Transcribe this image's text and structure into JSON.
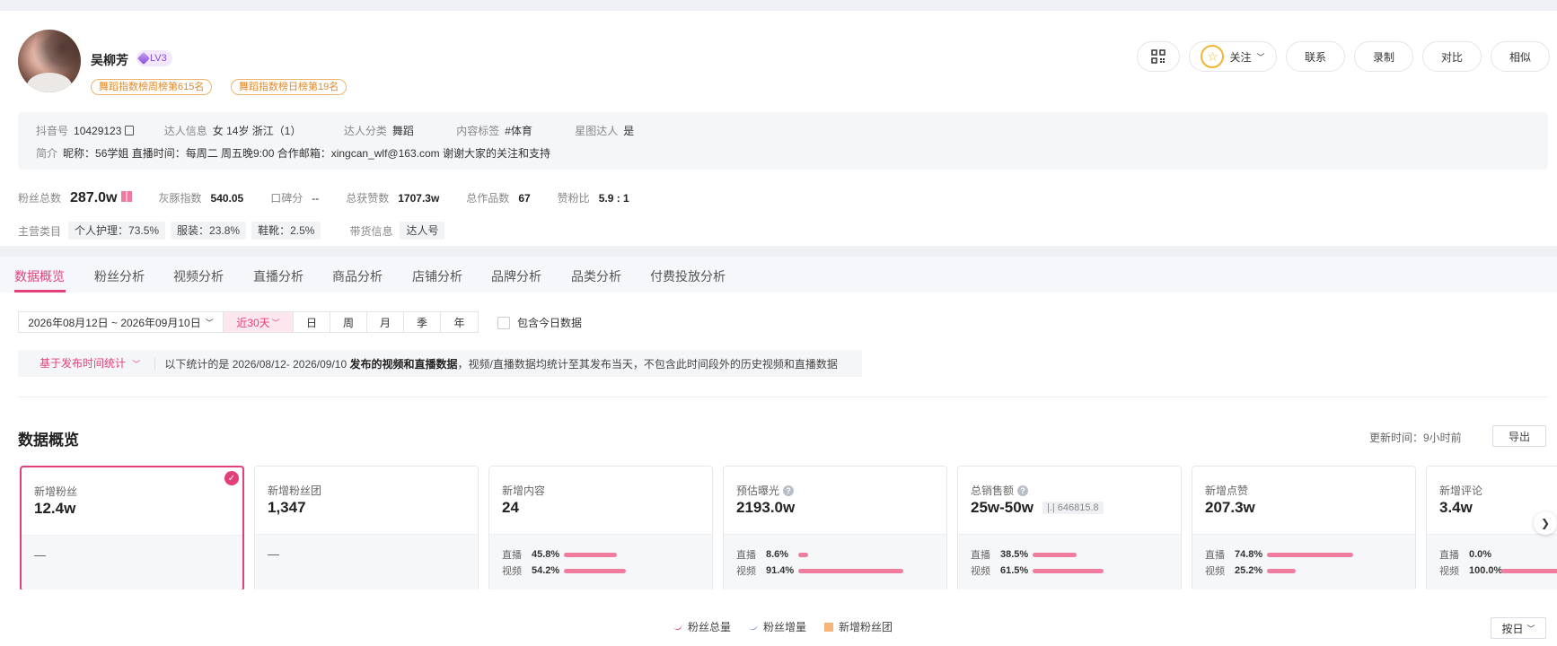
{
  "profile": {
    "name": "吴柳芳",
    "level": "LV3",
    "ranks": [
      "舞蹈指数榜周榜第615名",
      "舞蹈指数榜日榜第19名"
    ],
    "buttons": {
      "follow": "关注",
      "contact": "联系",
      "record": "录制",
      "compare": "对比",
      "similar": "相似"
    },
    "info": {
      "douyin_label": "抖音号",
      "douyin_value": "10429123",
      "talent_label": "达人信息",
      "talent_value": "女 14岁 浙江（1）",
      "category_label": "达人分类",
      "category_value": "舞蹈",
      "tag_label": "内容标签",
      "tag_value": "#体育",
      "star_label": "星图达人",
      "star_value": "是",
      "bio_label": "简介",
      "bio_value": "昵称：56学姐 直播时间：每周二 周五晚9:00 合作邮箱：xingcan_wlf@163.com 谢谢大家的关注和支持"
    },
    "stats": {
      "fans_label": "粉丝总数",
      "fans_value": "287.0w",
      "index_label": "灰豚指数",
      "index_value": "540.05",
      "rep_label": "口碑分",
      "rep_value": "--",
      "likes_label": "总获赞数",
      "likes_value": "1707.3w",
      "works_label": "总作品数",
      "works_value": "67",
      "ratio_label": "赞粉比",
      "ratio_value": "5.9 : 1"
    },
    "cats": {
      "main_label": "主营类目",
      "items": [
        "个人护理：73.5%",
        "服装：23.8%",
        "鞋靴：2.5%"
      ],
      "goods_label": "带货信息",
      "goods_value": "达人号"
    }
  },
  "tabs": [
    "数据概览",
    "粉丝分析",
    "视频分析",
    "直播分析",
    "商品分析",
    "店铺分析",
    "品牌分析",
    "品类分析",
    "付费投放分析"
  ],
  "filters": {
    "date_range": "2026年08月12日 ~ 2026年09月10日",
    "recent": "近30天",
    "periods": [
      "日",
      "周",
      "月",
      "季",
      "年"
    ],
    "include_today": "包含今日数据"
  },
  "notice": {
    "basis": "基于发布时间统计",
    "prefix": "以下统计的是 2026/08/12- 2026/09/10 ",
    "bold": "发布的视频和直播数据",
    "suffix": "，视频/直播数据均统计至其发布当天，不包含此时间段外的历史视频和直播数据"
  },
  "overview": {
    "title": "数据概览",
    "update_time": "更新时间：9小时前",
    "export": "导出",
    "cards": [
      {
        "title": "新增粉丝",
        "value": "12.4w",
        "dash": "—"
      },
      {
        "title": "新增粉丝团",
        "value": "1,347",
        "dash": "—"
      },
      {
        "title": "新增内容",
        "value": "24",
        "live_label": "直播",
        "live_pct": "45.8%",
        "live_frac": 0.458,
        "video_label": "视频",
        "video_pct": "54.2%",
        "video_frac": 0.542
      },
      {
        "title": "预估曝光",
        "value": "2193.0w",
        "live_label": "直播",
        "live_pct": "8.6%",
        "live_frac": 0.086,
        "video_label": "视频",
        "video_pct": "91.4%",
        "video_frac": 0.914
      },
      {
        "title": "总销售额",
        "value": "25w-50w",
        "extra": "646815.8",
        "live_label": "直播",
        "live_pct": "38.5%",
        "live_frac": 0.385,
        "video_label": "视频",
        "video_pct": "61.5%",
        "video_frac": 0.615
      },
      {
        "title": "新增点赞",
        "value": "207.3w",
        "live_label": "直播",
        "live_pct": "74.8%",
        "live_frac": 0.748,
        "video_label": "视频",
        "video_pct": "25.2%",
        "video_frac": 0.252
      },
      {
        "title": "新增评论",
        "value": "3.4w",
        "live_label": "直播",
        "live_pct": "0.0%",
        "live_frac": 0.0,
        "video_label": "视频",
        "video_pct": "100.0%",
        "video_frac": 1.0
      }
    ]
  },
  "legend": [
    "粉丝总量",
    "粉丝增量",
    "新增粉丝团"
  ],
  "by_day": "按日",
  "colors": {
    "accent": "#e3407a",
    "bar": "#f07da0",
    "rank": "#e08a2c"
  }
}
